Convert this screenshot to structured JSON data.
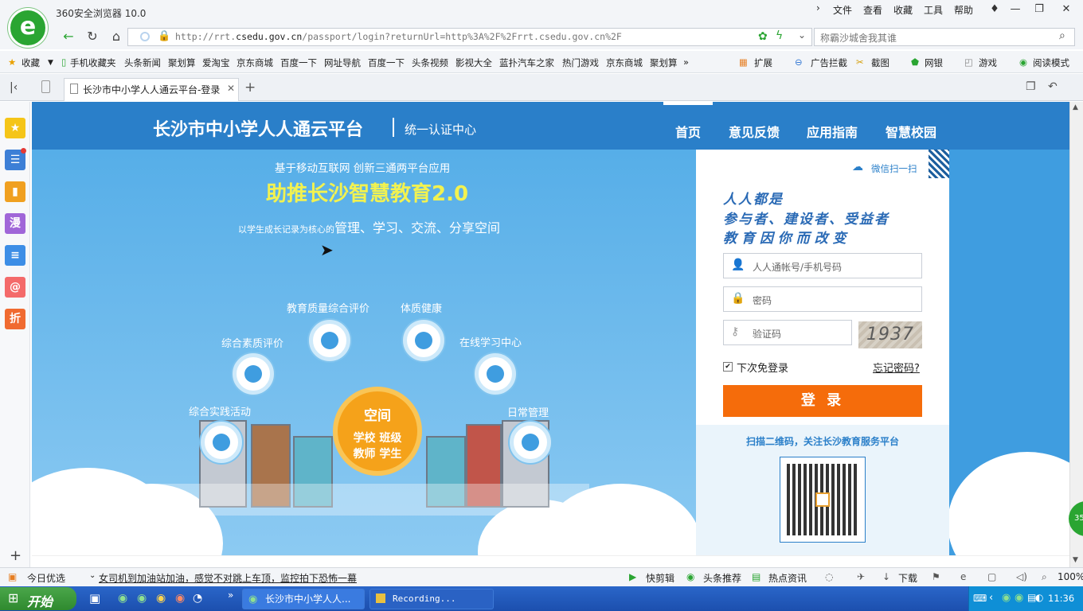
{
  "browser": {
    "app_title": "360安全浏览器 10.0",
    "menu": [
      "文件",
      "查看",
      "收藏",
      "工具",
      "帮助"
    ],
    "url_prefix": "http://rrt.",
    "url_domain": "csedu.gov.cn",
    "url_rest": "/passport/login?returnUrl=http%3A%2F%2Frrt.csedu.gov.cn%2F",
    "search_placeholder": "称霸沙城舍我其谁",
    "bookmarks": [
      "收藏",
      "手机收藏夹",
      "头条新闻",
      "聚划算",
      "爱淘宝",
      "京东商城",
      "百度一下",
      "网址导航",
      "百度一下",
      "头条视频",
      "影视大全",
      "蓝扑汽车之家",
      "热门游戏",
      "京东商城",
      "聚划算"
    ],
    "right_tools": [
      "扩展",
      "广告拦截",
      "截图",
      "网银",
      "游戏",
      "阅读模式"
    ],
    "tab_title": "长沙市中小学人人通云平台-登录"
  },
  "site": {
    "title": "长沙市中小学人人通云平台",
    "subtitle": "统一认证中心",
    "nav": [
      "首页",
      "意见反馈",
      "应用指南",
      "智慧校园"
    ],
    "slogan1": "基于移动互联网   创新三通两平台应用",
    "slogan2": "助推长沙智慧教育2.0",
    "slogan3_small": "以学生成长记录为核心的",
    "slogan3_big": "管理、学习、交流、分享空间",
    "features": [
      "教育质量综合评价",
      "体质健康",
      "综合素质评价",
      "在线学习中心",
      "综合实践活动",
      "日常管理"
    ],
    "center_title": "空间",
    "center_line1": "学校  班级",
    "center_line2": "教师  学生"
  },
  "login": {
    "wechat_scan": "微信扫一扫",
    "motto": [
      "人人都是",
      "参与者、建设者、受益者",
      "教  育  因  你  而  改  变"
    ],
    "username_placeholder": "人人通帐号/手机号码",
    "password_placeholder": "密码",
    "captcha_placeholder": "验证码",
    "captcha_text": "1937",
    "remember_label": "下次免登录",
    "forgot_label": "忘记密码?",
    "login_button": "登 录",
    "qr_caption": "扫描二维码，关注长沙教育服务平台"
  },
  "statusbar": {
    "left_label": "今日优选",
    "news": "女司机到加油站加油，感觉不对跳上车顶，监控拍下恐怖一幕",
    "tools": [
      "快剪辑",
      "头条推荐",
      "热点资讯",
      "下载"
    ],
    "zoom": "100%"
  },
  "taskbar": {
    "start": "开始",
    "tasks": [
      "长沙市中小学人人...",
      "Recording..."
    ],
    "time": "11:36"
  },
  "float_badge": "35"
}
